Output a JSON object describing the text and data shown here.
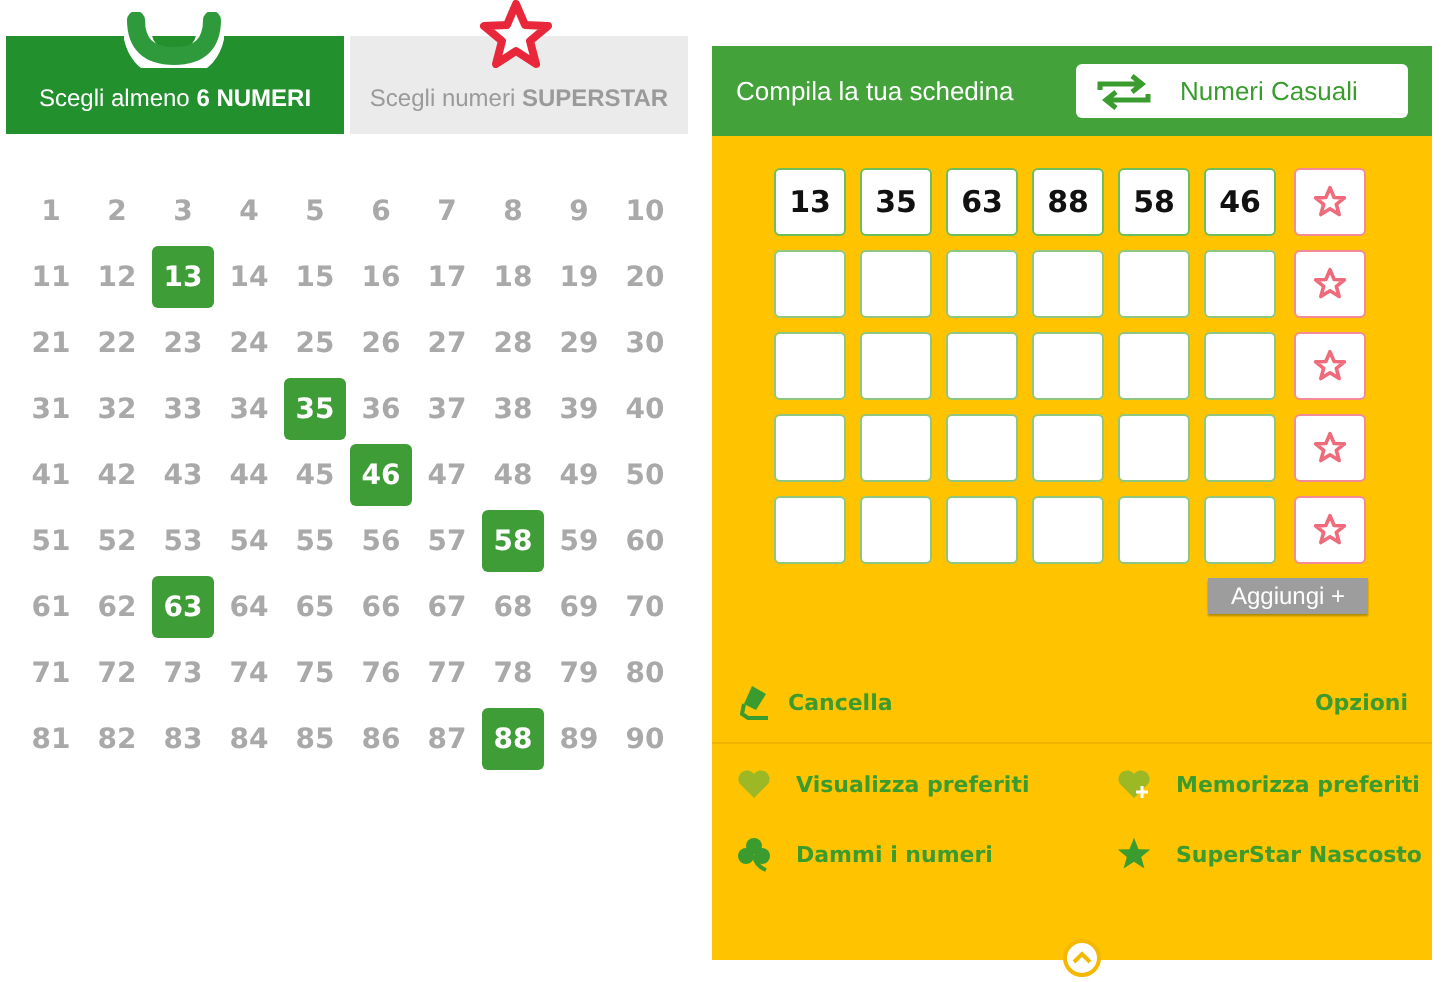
{
  "tabs": [
    {
      "label": "Scegli almeno **6 NUMERI**",
      "selected": true
    },
    {
      "label": "Scegli numeri **SUPERSTAR**",
      "selected": false
    }
  ],
  "numbers": [
    {
      "label": "1",
      "selected": false
    },
    {
      "label": "2",
      "selected": false
    },
    {
      "label": "3",
      "selected": false
    },
    {
      "label": "4",
      "selected": false
    },
    {
      "label": "5",
      "selected": false
    },
    {
      "label": "6",
      "selected": false
    },
    {
      "label": "7",
      "selected": false
    },
    {
      "label": "8",
      "selected": false
    },
    {
      "label": "9",
      "selected": false
    },
    {
      "label": "10",
      "selected": false
    },
    {
      "label": "11",
      "selected": false
    },
    {
      "label": "12",
      "selected": false
    },
    {
      "label": "13",
      "selected": true
    },
    {
      "label": "14",
      "selected": false
    },
    {
      "label": "15",
      "selected": false
    },
    {
      "label": "16",
      "selected": false
    },
    {
      "label": "17",
      "selected": false
    },
    {
      "label": "18",
      "selected": false
    },
    {
      "label": "19",
      "selected": false
    },
    {
      "label": "20",
      "selected": false
    },
    {
      "label": "21",
      "selected": false
    },
    {
      "label": "22",
      "selected": false
    },
    {
      "label": "23",
      "selected": false
    },
    {
      "label": "24",
      "selected": false
    },
    {
      "label": "25",
      "selected": false
    },
    {
      "label": "26",
      "selected": false
    },
    {
      "label": "27",
      "selected": false
    },
    {
      "label": "28",
      "selected": false
    },
    {
      "label": "29",
      "selected": false
    },
    {
      "label": "30",
      "selected": false
    },
    {
      "label": "31",
      "selected": false
    },
    {
      "label": "32",
      "selected": false
    },
    {
      "label": "33",
      "selected": false
    },
    {
      "label": "34",
      "selected": false
    },
    {
      "label": "35",
      "selected": true
    },
    {
      "label": "36",
      "selected": false
    },
    {
      "label": "37",
      "selected": false
    },
    {
      "label": "38",
      "selected": false
    },
    {
      "label": "39",
      "selected": false
    },
    {
      "label": "40",
      "selected": false
    },
    {
      "label": "41",
      "selected": false
    },
    {
      "label": "42",
      "selected": false
    },
    {
      "label": "43",
      "selected": false
    },
    {
      "label": "44",
      "selected": false
    },
    {
      "label": "45",
      "selected": false
    },
    {
      "label": "46",
      "selected": true
    },
    {
      "label": "47",
      "selected": false
    },
    {
      "label": "48",
      "selected": false
    },
    {
      "label": "49",
      "selected": false
    },
    {
      "label": "50",
      "selected": false
    },
    {
      "label": "51",
      "selected": false
    },
    {
      "label": "52",
      "selected": false
    },
    {
      "label": "53",
      "selected": false
    },
    {
      "label": "54",
      "selected": false
    },
    {
      "label": "55",
      "selected": false
    },
    {
      "label": "56",
      "selected": false
    },
    {
      "label": "57",
      "selected": false
    },
    {
      "label": "58",
      "selected": true
    },
    {
      "label": "59",
      "selected": false
    },
    {
      "label": "60",
      "selected": false
    },
    {
      "label": "61",
      "selected": false
    },
    {
      "label": "62",
      "selected": false
    },
    {
      "label": "63",
      "selected": true
    },
    {
      "label": "64",
      "selected": false
    },
    {
      "label": "65",
      "selected": false
    },
    {
      "label": "66",
      "selected": false
    },
    {
      "label": "67",
      "selected": false
    },
    {
      "label": "68",
      "selected": false
    },
    {
      "label": "69",
      "selected": false
    },
    {
      "label": "70",
      "selected": false
    },
    {
      "label": "71",
      "selected": false
    },
    {
      "label": "72",
      "selected": false
    },
    {
      "label": "73",
      "selected": false
    },
    {
      "label": "74",
      "selected": false
    },
    {
      "label": "75",
      "selected": false
    },
    {
      "label": "76",
      "selected": false
    },
    {
      "label": "77",
      "selected": false
    },
    {
      "label": "78",
      "selected": false
    },
    {
      "label": "79",
      "selected": false
    },
    {
      "label": "80",
      "selected": false
    },
    {
      "label": "81",
      "selected": false
    },
    {
      "label": "82",
      "selected": false
    },
    {
      "label": "83",
      "selected": false
    },
    {
      "label": "84",
      "selected": false
    },
    {
      "label": "85",
      "selected": false
    },
    {
      "label": "86",
      "selected": false
    },
    {
      "label": "87",
      "selected": false
    },
    {
      "label": "88",
      "selected": true
    },
    {
      "label": "89",
      "selected": false
    },
    {
      "label": "90",
      "selected": false
    }
  ],
  "panel": {
    "title": "Compila la tua schedina",
    "random_button": "Numeri Casuali"
  },
  "tickets": [
    {
      "empty": false,
      "numbers": [
        "13",
        "35",
        "63",
        "88",
        "58",
        "46"
      ]
    },
    {
      "empty": true
    },
    {
      "empty": true
    },
    {
      "empty": true
    },
    {
      "empty": true
    }
  ],
  "add_button": "Aggiungi +",
  "clear_link": "Cancella",
  "options_link": "Opzioni",
  "options": [
    {
      "kind": "heart",
      "label": "Visualizza preferiti"
    },
    {
      "kind": "heart-plus",
      "label": "Memorizza preferiti"
    },
    {
      "kind": "clover",
      "label": "Dammi i numeri"
    },
    {
      "kind": "star",
      "label": "SuperStar Nascosto"
    }
  ]
}
